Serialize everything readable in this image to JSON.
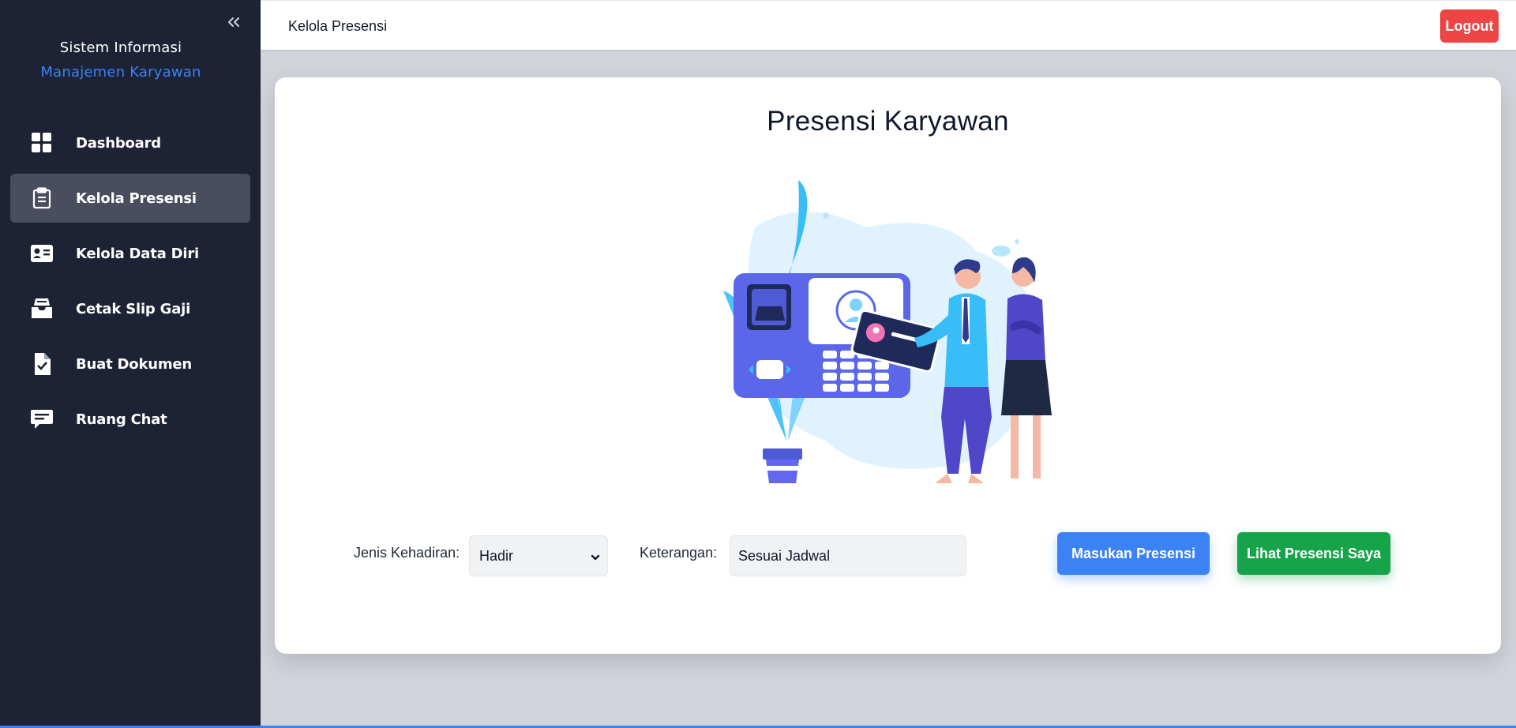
{
  "sidebar": {
    "brand_line1": "Sistem Informasi",
    "brand_line2": "Manajemen Karyawan",
    "items": [
      {
        "label": "Dashboard",
        "icon": "dashboard-grid-icon",
        "active": false
      },
      {
        "label": "Kelola Presensi",
        "icon": "clipboard-icon",
        "active": true
      },
      {
        "label": "Kelola Data Diri",
        "icon": "id-card-icon",
        "active": false
      },
      {
        "label": "Cetak Slip Gaji",
        "icon": "inbox-tray-icon",
        "active": false
      },
      {
        "label": "Buat Dokumen",
        "icon": "file-check-icon",
        "active": false
      },
      {
        "label": "Ruang Chat",
        "icon": "chat-bubble-icon",
        "active": false
      }
    ]
  },
  "topbar": {
    "title": "Kelola Presensi",
    "logout_label": "Logout"
  },
  "main": {
    "title": "Presensi Karyawan",
    "form": {
      "jenis_label": "Jenis Kehadiran:",
      "jenis_value": "Hadir",
      "keterangan_label": "Keterangan:",
      "keterangan_value": "Sesuai Jadwal"
    },
    "buttons": {
      "masukan": "Masukan Presensi",
      "lihat": "Lihat Presensi Saya"
    }
  },
  "colors": {
    "sidebar_bg": "#1e2235",
    "active_item_bg": "#4a4d5d",
    "brand_accent": "#3b82f6",
    "logout": "#ef4444",
    "primary_button": "#3b82f6",
    "success_button": "#16a34a"
  }
}
